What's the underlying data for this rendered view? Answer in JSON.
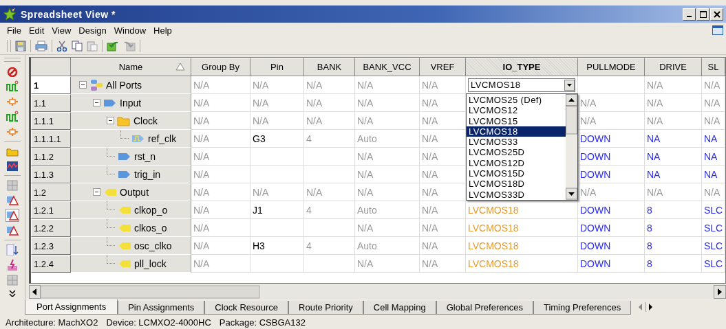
{
  "window": {
    "title": "Spreadsheet View *"
  },
  "menu": [
    "File",
    "Edit",
    "View",
    "Design",
    "Window",
    "Help"
  ],
  "ports": {
    "columns": [
      {
        "label": "Name",
        "selected": false,
        "sorted": true
      },
      {
        "label": "Group By",
        "selected": false
      },
      {
        "label": "Pin",
        "selected": false
      },
      {
        "label": "BANK",
        "selected": false
      },
      {
        "label": "BANK_VCC",
        "selected": false
      },
      {
        "label": "VREF",
        "selected": false
      },
      {
        "label": "IO_TYPE",
        "selected": true
      },
      {
        "label": "PULLMODE",
        "selected": false
      },
      {
        "label": "DRIVE",
        "selected": false
      },
      {
        "label": "SL",
        "selected": false
      }
    ],
    "rows": [
      {
        "number": "1",
        "name": "All Ports",
        "kind": "all",
        "expanded": true,
        "selected": true,
        "editing": true,
        "cells": {
          "group_by": "N/A",
          "pin": "N/A",
          "bank": "N/A",
          "bank_vcc": "N/A",
          "vref": "N/A",
          "io_type": "LVCMOS18",
          "drive": "N/A",
          "column_11": "N/A"
        },
        "children": [
          {
            "number": "1.1",
            "name": "Input",
            "kind": "input",
            "expanded": true,
            "selected": false,
            "cells": {
              "group_by": "N/A",
              "pin": "N/A",
              "bank": "N/A",
              "bank_vcc": "N/A",
              "vref": "N/A",
              "pullmode": "N/A",
              "drive": "N/A",
              "column_11": "N/A"
            },
            "children": [
              {
                "number": "1.1.1",
                "name": "Clock",
                "kind": "folder",
                "expanded": true,
                "selected": false,
                "cells": {
                  "group_by": "N/A",
                  "pin": "N/A",
                  "bank": "N/A",
                  "bank_vcc": "N/A",
                  "vref": "N/A",
                  "pullmode": "N/A",
                  "drive": "N/A",
                  "column_11": "N/A"
                },
                "children": [
                  {
                    "number": "1.1.1.1",
                    "name": "ref_clk",
                    "kind": "clock",
                    "selected": false,
                    "cells": {
                      "group_by": "N/A",
                      "pin": "G3",
                      "bank": "4",
                      "bank_vcc": "Auto",
                      "vref": "N/A",
                      "pullmode": "DOWN",
                      "drive": "NA",
                      "column_11": "NA"
                    }
                  }
                ]
              },
              {
                "number": "1.1.2",
                "name": "rst_n",
                "kind": "input",
                "selected": false,
                "cells": {
                  "group_by": "N/A",
                  "bank_vcc": "N/A",
                  "vref": "N/A",
                  "pullmode": "DOWN",
                  "drive": "NA",
                  "column_11": "NA"
                }
              },
              {
                "number": "1.1.3",
                "name": "trig_in",
                "kind": "input",
                "selected": false,
                "cells": {
                  "group_by": "N/A",
                  "bank_vcc": "N/A",
                  "vref": "N/A",
                  "pullmode": "DOWN",
                  "drive": "NA",
                  "column_11": "NA"
                }
              }
            ]
          },
          {
            "number": "1.2",
            "name": "Output",
            "kind": "output",
            "expanded": true,
            "selected": false,
            "cells": {
              "group_by": "N/A",
              "pin": "N/A",
              "bank": "N/A",
              "bank_vcc": "N/A",
              "vref": "N/A",
              "pullmode": "N/A",
              "drive": "N/A",
              "column_11": "N/A"
            },
            "children": [
              {
                "number": "1.2.1",
                "name": "clkop_o",
                "kind": "output",
                "selected": false,
                "cells": {
                  "group_by": "N/A",
                  "pin": "J1",
                  "bank": "4",
                  "bank_vcc": "Auto",
                  "vref": "N/A",
                  "io_type": "LVCMOS18",
                  "pullmode": "DOWN",
                  "drive": "8",
                  "column_11": "SLC"
                }
              },
              {
                "number": "1.2.2",
                "name": "clkos_o",
                "kind": "output",
                "selected": false,
                "cells": {
                  "group_by": "N/A",
                  "bank_vcc": "N/A",
                  "vref": "N/A",
                  "io_type": "LVCMOS18",
                  "pullmode": "DOWN",
                  "drive": "8",
                  "column_11": "SLC"
                }
              },
              {
                "number": "1.2.3",
                "name": "osc_clko",
                "kind": "output",
                "selected": false,
                "cells": {
                  "group_by": "N/A",
                  "pin": "H3",
                  "bank": "4",
                  "bank_vcc": "Auto",
                  "vref": "N/A",
                  "io_type": "LVCMOS18",
                  "pullmode": "DOWN",
                  "drive": "8",
                  "column_11": "SLC"
                }
              },
              {
                "number": "1.2.4",
                "name": "pll_lock",
                "kind": "output",
                "selected": false,
                "cells": {
                  "group_by": "N/A",
                  "bank_vcc": "N/A",
                  "vref": "N/A",
                  "io_type": "LVCMOS18",
                  "pullmode": "DOWN",
                  "drive": "8",
                  "column_11": "SLC"
                }
              }
            ]
          }
        ]
      }
    ],
    "io_type_dropdown": [
      {
        "label": "LVCMOS25 (Def)",
        "selected": false
      },
      {
        "label": "LVCMOS12",
        "selected": false
      },
      {
        "label": "LVCMOS15",
        "selected": false
      },
      {
        "label": "LVCMOS18",
        "selected": true
      },
      {
        "label": "LVCMOS33",
        "selected": false
      },
      {
        "label": "LVCMOS25D",
        "selected": false
      },
      {
        "label": "LVCMOS12D",
        "selected": false
      },
      {
        "label": "LVCMOS15D",
        "selected": false
      },
      {
        "label": "LVCMOS18D",
        "selected": false
      },
      {
        "label": "LVCMOS33D",
        "selected": false
      }
    ]
  },
  "tabs": [
    {
      "label": "Port Assignments",
      "selected": true
    },
    {
      "label": "Pin Assignments",
      "selected": false
    },
    {
      "label": "Clock Resource",
      "selected": false
    },
    {
      "label": "Route Priority",
      "selected": false
    },
    {
      "label": "Cell Mapping",
      "selected": false
    },
    {
      "label": "Global Preferences",
      "selected": false
    },
    {
      "label": "Timing Preferences",
      "selected": false
    }
  ],
  "status_bar": [
    "Architecture: MachXO2",
    "Device: LCMXO2-4000HC",
    "Package: CSBGA132"
  ]
}
